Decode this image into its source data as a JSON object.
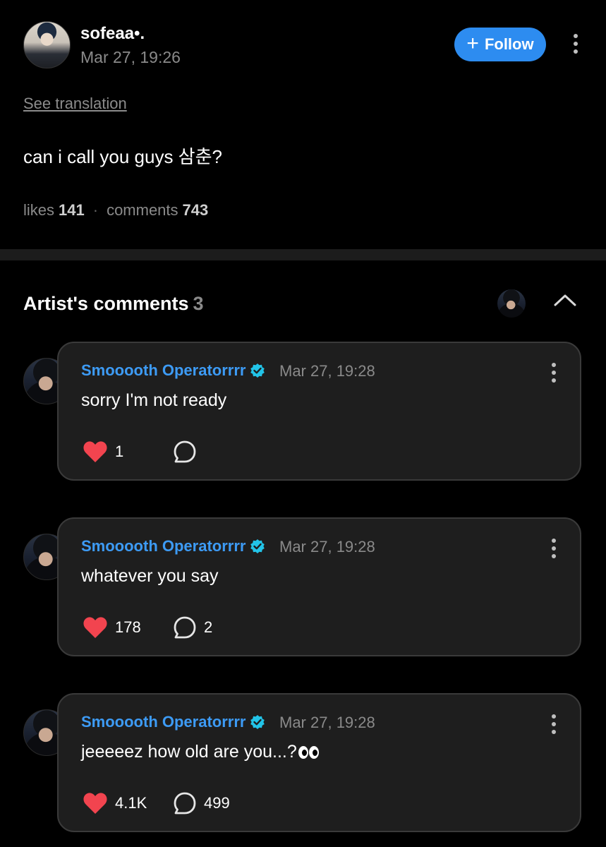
{
  "post": {
    "author": "sofeaa•.",
    "time": "Mar 27, 19:26",
    "follow_label": "Follow",
    "see_translation": "See translation",
    "body": "can i call you guys 삼춘?",
    "likes_label": "likes",
    "likes": "141",
    "comments_label": "comments",
    "comments": "743"
  },
  "artist_comments": {
    "title": "Artist's comments",
    "count": "3",
    "items": [
      {
        "name": "Smooooth Operatorrrr",
        "time": "Mar 27, 19:28",
        "text": "sorry I'm not ready",
        "likes": "1",
        "replies": ""
      },
      {
        "name": "Smooooth Operatorrrr",
        "time": "Mar 27, 19:28",
        "text": "whatever you say",
        "likes": "178",
        "replies": "2"
      },
      {
        "name": "Smooooth Operatorrrr",
        "time": "Mar 27, 19:28",
        "text": "jeeeeez how old are you...?",
        "likes": "4.1K",
        "replies": "499"
      }
    ]
  },
  "colors": {
    "accent": "#2d8cf0",
    "artist_name": "#3d9bf5",
    "verified": "#22c4e8",
    "heart": "#f2444f",
    "card_bg": "#1e1e1e"
  },
  "icons": {
    "follow": "plus-icon",
    "more": "kebab-icon",
    "collapse": "chevron-up-icon",
    "verified": "verified-badge-icon",
    "like": "heart-icon",
    "reply": "speech-bubble-icon",
    "emoji": "eyes-emoji"
  }
}
